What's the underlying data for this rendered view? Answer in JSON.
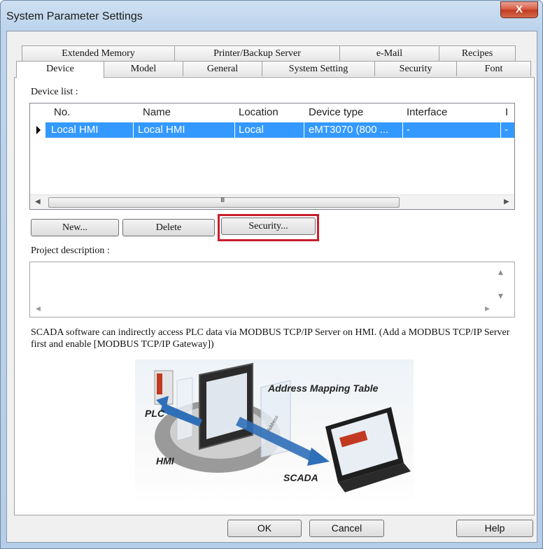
{
  "window": {
    "title": "System Parameter Settings",
    "close_glyph": "X"
  },
  "tabs": {
    "back_row": [
      "Extended Memory",
      "Printer/Backup Server",
      "e-Mail",
      "Recipes"
    ],
    "front_row": [
      "Device",
      "Model",
      "General",
      "System Setting",
      "Security",
      "Font"
    ],
    "active": "Device"
  },
  "device_list": {
    "label": "Device list :",
    "columns": [
      "No.",
      "Name",
      "Location",
      "Device type",
      "Interface",
      "I"
    ],
    "rows": [
      {
        "no": "Local HMI",
        "name": "Local HMI",
        "location": "Local",
        "device_type": "eMT3070 (800 ...",
        "interface": "-",
        "extra": "-"
      }
    ],
    "scroll_grip": "III"
  },
  "buttons": {
    "new": "New...",
    "delete": "Delete",
    "security": "Security...",
    "ok": "OK",
    "cancel": "Cancel",
    "help": "Help"
  },
  "project_description": {
    "label": "Project description :",
    "value": ""
  },
  "info_text": "SCADA software can indirectly access PLC data via MODBUS TCP/IP Server on HMI. (Add a MODBUS TCP/IP Server first and enable [MODBUS TCP/IP Gateway])",
  "diagram": {
    "title": "Address Mapping Table",
    "labels": {
      "plc": "PLC",
      "hmi": "HMI",
      "scada": "SCADA",
      "address": "Address"
    }
  },
  "colors": {
    "selection": "#3399ff",
    "highlight_border": "#c81e2a",
    "arrow_blue": "#2f6fb8"
  }
}
